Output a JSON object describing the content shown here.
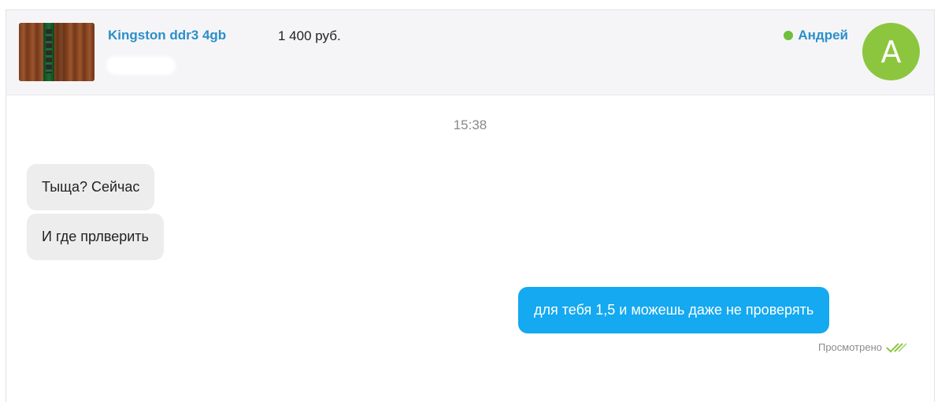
{
  "listing": {
    "title": "Kingston ddr3 4gb",
    "price": "1 400 руб.",
    "thumbnail_icon": "ram-module-photo"
  },
  "contact": {
    "name": "Андрей",
    "status_color": "#6fbf3c",
    "avatar_initial": "А",
    "avatar_color": "#8cc63f"
  },
  "chat": {
    "time": "15:38",
    "incoming": [
      {
        "text": "Тыща? Сейчас"
      },
      {
        "text": "И где прлверить"
      }
    ],
    "outgoing": [
      {
        "text": "для тебя 1,5 и можешь даже не проверять",
        "status": "Просмотрено"
      }
    ],
    "outgoing_color": "#14a9f0",
    "read_icon": "double-check-icon"
  }
}
